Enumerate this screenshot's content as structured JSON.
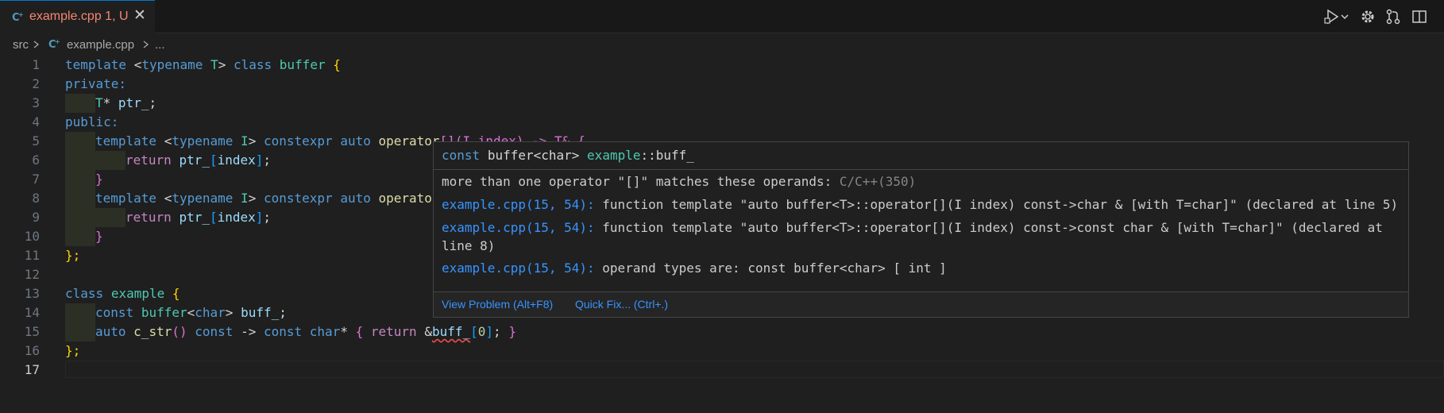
{
  "tab": {
    "filename": "example.cpp",
    "status": "1, U",
    "close": "✕",
    "icon": "cpp-file-icon"
  },
  "toolbar": {
    "icons": [
      "run-debug-icon",
      "chevron-down-icon",
      "gear-icon",
      "source-control-icon",
      "split-editor-icon"
    ]
  },
  "breadcrumb": {
    "folder": "src",
    "file": "example.cpp",
    "more": "..."
  },
  "editor": {
    "line_numbers": [
      "1",
      "2",
      "3",
      "4",
      "5",
      "6",
      "7",
      "8",
      "9",
      "10",
      "11",
      "12",
      "13",
      "14",
      "15",
      "16",
      "17"
    ],
    "active_line": "17",
    "t": {
      "template": "template",
      "lt": "<",
      "typename": "typename",
      "T": "T",
      "gt": ">",
      "class": "class",
      "buffer": "buffer",
      "lbrace": "{",
      "rbrace": "}",
      "private": "private:",
      "public": "public:",
      "star": "*",
      "ptr_": "ptr_",
      "semi": ";",
      "I": "I",
      "constexpr": "constexpr",
      "auto": "auto",
      "operator_trunc": "operator",
      "operator_tail": "[](I index) -> T& {",
      "return": "return",
      "lbr": "[",
      "index": "index",
      "rbr": "]",
      "rbrace_semi": "};",
      "example": "example",
      "const": "const",
      "char": "char",
      "buff_": "buff_",
      "c_str": "c_str",
      "parens": "()",
      "arrow": "->",
      "amp": "&",
      "zero": "0",
      "operato_trunc": "operato"
    }
  },
  "hover": {
    "signature": {
      "const": "const",
      "type": "buffer<char>",
      "scope": "example",
      "sep": "::",
      "name": "buff_"
    },
    "message": "more than one operator \"[]\" matches these operands: ",
    "source": "C/C++(350)",
    "details": [
      {
        "loc": "example.cpp(15, 54):",
        "text": " function template \"auto buffer<T>::operator[](I index) const->char & [with T=char]\" (declared at line 5)"
      },
      {
        "loc": "example.cpp(15, 54):",
        "text": " function template \"auto buffer<T>::operator[](I index) const->const char & [with T=char]\" (declared at"
      },
      {
        "loc": "",
        "text": "line 8)"
      },
      {
        "loc": "example.cpp(15, 54):",
        "text": " operand types are: const buffer<char> [ int ]"
      }
    ],
    "actions": {
      "view_problem": "View Problem (Alt+F8)",
      "quick_fix": "Quick Fix... (Ctrl+.)"
    }
  },
  "colors": {
    "error": "#f48771",
    "link": "#3794ff",
    "keyword": "#569cd6",
    "type": "#4ec9b0"
  }
}
